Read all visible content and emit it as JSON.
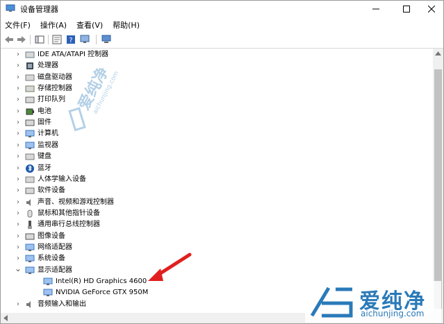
{
  "window": {
    "title": "设备管理器",
    "controls": {
      "minimize": "—",
      "maximize": "☐",
      "close": "✕"
    }
  },
  "menu": [
    "文件(F)",
    "操作(A)",
    "查看(V)",
    "帮助(H)"
  ],
  "tree": {
    "items": [
      {
        "label": "IDE ATA/ATAPI 控制器",
        "icon": "ide-controller-icon",
        "expanded": false
      },
      {
        "label": "处理器",
        "icon": "processor-icon",
        "expanded": false
      },
      {
        "label": "磁盘驱动器",
        "icon": "disk-drive-icon",
        "expanded": false
      },
      {
        "label": "存储控制器",
        "icon": "storage-controller-icon",
        "expanded": false
      },
      {
        "label": "打印队列",
        "icon": "print-queue-icon",
        "expanded": false
      },
      {
        "label": "电池",
        "icon": "battery-icon",
        "expanded": false
      },
      {
        "label": "固件",
        "icon": "firmware-icon",
        "expanded": false
      },
      {
        "label": "计算机",
        "icon": "computer-icon",
        "expanded": false
      },
      {
        "label": "监视器",
        "icon": "monitor-icon",
        "expanded": false
      },
      {
        "label": "键盘",
        "icon": "keyboard-icon",
        "expanded": false
      },
      {
        "label": "蓝牙",
        "icon": "bluetooth-icon",
        "expanded": false
      },
      {
        "label": "人体学输入设备",
        "icon": "hid-icon",
        "expanded": false
      },
      {
        "label": "软件设备",
        "icon": "software-device-icon",
        "expanded": false
      },
      {
        "label": "声音、视频和游戏控制器",
        "icon": "sound-icon",
        "expanded": false
      },
      {
        "label": "鼠标和其他指针设备",
        "icon": "mouse-icon",
        "expanded": false
      },
      {
        "label": "通用串行总线控制器",
        "icon": "usb-icon",
        "expanded": false
      },
      {
        "label": "图像设备",
        "icon": "imaging-device-icon",
        "expanded": false
      },
      {
        "label": "网络适配器",
        "icon": "network-adapter-icon",
        "expanded": false
      },
      {
        "label": "系统设备",
        "icon": "system-device-icon",
        "expanded": false
      },
      {
        "label": "显示适配器",
        "icon": "display-adapter-icon",
        "expanded": true
      },
      {
        "label": "Intel(R) HD Graphics 4600",
        "icon": "display-adapter-icon",
        "child": true
      },
      {
        "label": "NVIDIA GeForce GTX 950M",
        "icon": "display-adapter-icon",
        "child": true
      },
      {
        "label": "音频输入和输出",
        "icon": "audio-io-icon",
        "expanded": false
      }
    ]
  },
  "watermark": {
    "brand": "爱纯净",
    "url": "aichunjing.com",
    "color": "#2a7ab8"
  },
  "annotation": {
    "arrow_color": "#e02020"
  }
}
